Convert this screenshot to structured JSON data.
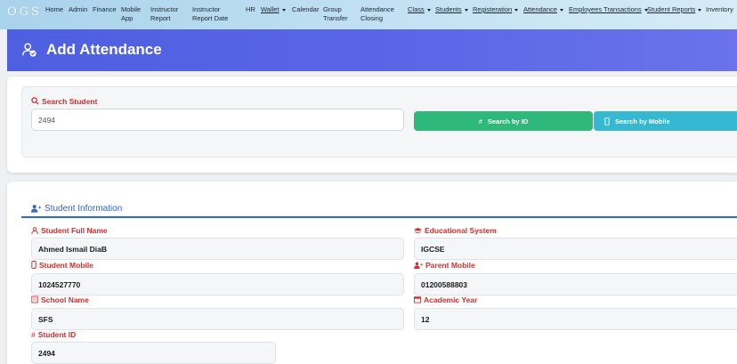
{
  "nav": {
    "logo": "OGS",
    "items": [
      {
        "label": "Home"
      },
      {
        "label": "Admin"
      },
      {
        "label": "Finance"
      },
      {
        "label": "Mobile App"
      },
      {
        "label": "Instructor Report"
      },
      {
        "label": "Instructor Report Date"
      },
      {
        "label": "HR"
      },
      {
        "label": "Wallet"
      },
      {
        "label": "Calendar"
      },
      {
        "label": "Group Transfer"
      },
      {
        "label": "Attendance Closing"
      },
      {
        "label": "Class"
      },
      {
        "label": "Students"
      },
      {
        "label": "Registeration"
      },
      {
        "label": "Attendance"
      },
      {
        "label": "Employees Transactions"
      },
      {
        "label": "Student Reports"
      },
      {
        "label": "Inventory"
      }
    ]
  },
  "header": {
    "title": "Add Attendance",
    "icon": "user-check-icon",
    "color": "#5865e6"
  },
  "search": {
    "label": "Search Student",
    "value": "2494",
    "by_id_label": "Search by ID",
    "by_mobile_label": "Search by Mobile",
    "by_id_color": "#2eb87a",
    "by_mobile_color": "#35b9d3"
  },
  "student_info": {
    "title": "Student Information",
    "full_name_label": "Student Full Name",
    "full_name": "Ahmed Ismail DiaB",
    "edu_system_label": "Educational System",
    "edu_system": "IGCSE",
    "mobile_label": "Student Mobile",
    "mobile": "1024527770",
    "parent_mobile_label": "Parent Mobile",
    "parent_mobile": "01200588803",
    "school_label": "School Name",
    "school": "SFS",
    "academic_year_label": "Academic Year",
    "academic_year": "12",
    "student_id_label": "Student ID",
    "student_id": "2494"
  },
  "colors": {
    "label_red": "#d32f2f",
    "section_blue": "#3465c8"
  }
}
